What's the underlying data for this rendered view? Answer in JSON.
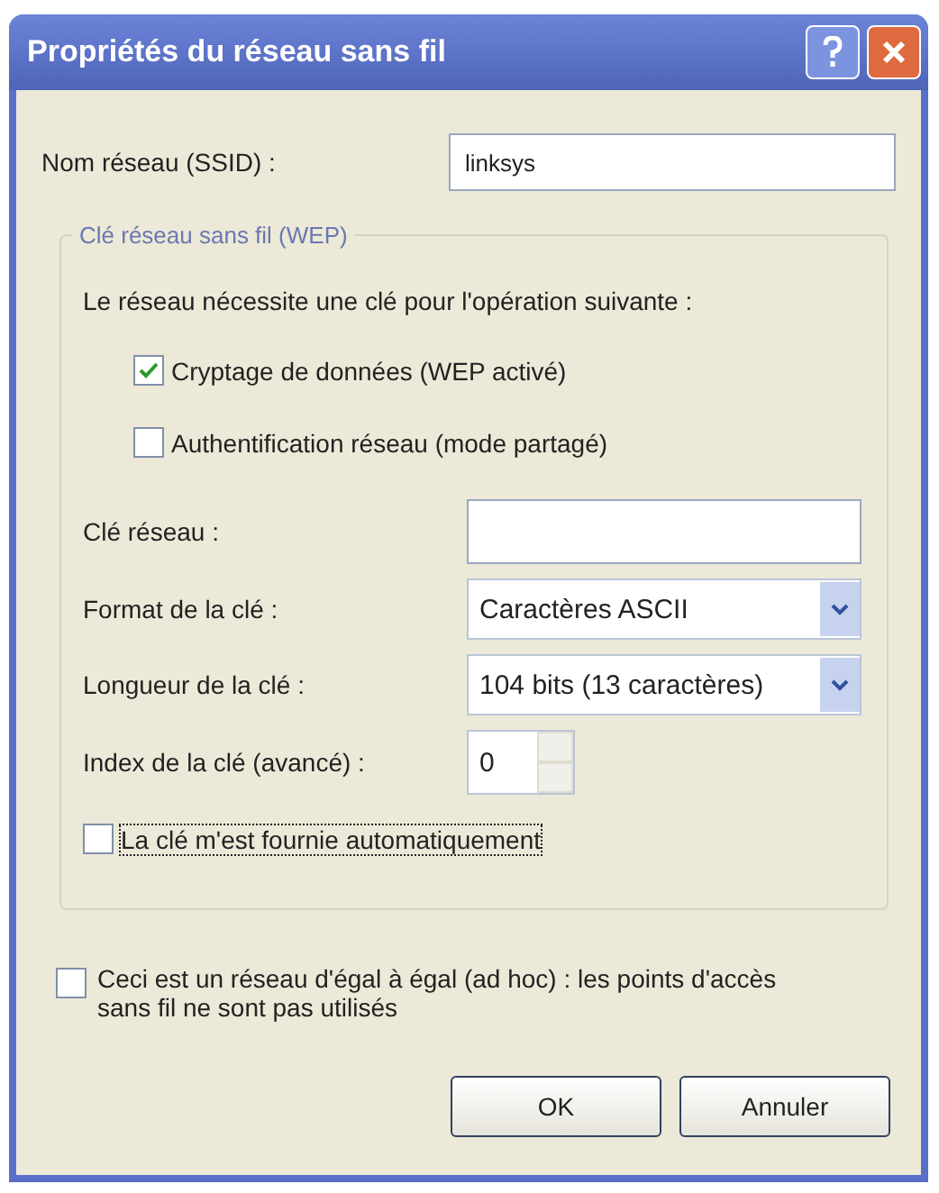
{
  "window": {
    "title": "Propriétés du réseau sans fil"
  },
  "ssid": {
    "label": "Nom réseau (SSID) :",
    "value": "linksys"
  },
  "group": {
    "legend": "Clé réseau sans fil (WEP)",
    "intro": "Le réseau nécessite une clé pour l'opération suivante :",
    "options": [
      {
        "label": "Cryptage de données (WEP activé)",
        "checked": true
      },
      {
        "label": "Authentification réseau (mode partagé)",
        "checked": false
      }
    ],
    "fields": [
      {
        "kind": "text",
        "label": "Clé réseau :"
      },
      {
        "kind": "select",
        "label": "Format de la clé :",
        "value": "Caractères ASCII"
      },
      {
        "kind": "select",
        "label": "Longueur de la clé :",
        "value": "104 bits (13 caractères)"
      },
      {
        "kind": "spin",
        "label": "Index de la clé (avancé) :",
        "value": "0"
      }
    ],
    "auto_key": {
      "label": "La clé m'est fournie automatiquement",
      "checked": false,
      "focused": true
    }
  },
  "adhoc": {
    "label": "Ceci est un réseau d'égal à égal (ad hoc) : les points d'accès sans fil ne sont pas utilisés",
    "checked": false
  },
  "buttons": [
    "OK",
    "Annuler"
  ]
}
